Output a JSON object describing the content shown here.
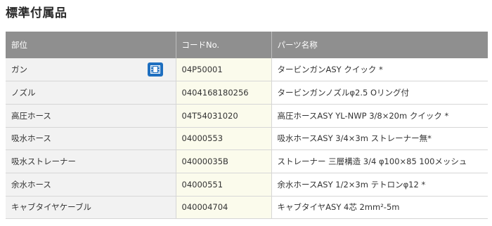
{
  "page": {
    "title": "標準付属品"
  },
  "table": {
    "headers": [
      "部位",
      "コードNo.",
      "パーツ名称"
    ],
    "rows": [
      {
        "part": "ガン",
        "code": "04P50001",
        "name": "タービンガンASY クイック *",
        "has_video": true
      },
      {
        "part": "ノズル",
        "code": "0404168180256",
        "name": "タービンガンノズルφ2.5 Oリング付"
      },
      {
        "part": "高圧ホース",
        "code": "04T54031020",
        "name": "高圧ホースASY YL-NWP 3/8×20m クイック *"
      },
      {
        "part": "吸水ホース",
        "code": "04000553",
        "name": "吸水ホースASY 3/4×3m ストレーナー無*"
      },
      {
        "part": "吸水ストレーナー",
        "code": "04000035B",
        "name": "ストレーナー 三層構造 3/4 φ100×85 100メッシュ"
      },
      {
        "part": "余水ホース",
        "code": "04000551",
        "name": "余水ホースASY 1/2×3m テトロンφ12 *"
      },
      {
        "part": "キャブタイヤケーブル",
        "code": "040004704",
        "name": "キャブタイヤASY 4芯 2mm²-5m"
      }
    ]
  },
  "icons": {
    "video": "video-film-icon"
  },
  "colors": {
    "header_bg": "#8f8f8f",
    "code_col_bg": "#fbfbec",
    "part_col_bg": "#f2f2f2",
    "video_btn": "#1e6fc0"
  }
}
